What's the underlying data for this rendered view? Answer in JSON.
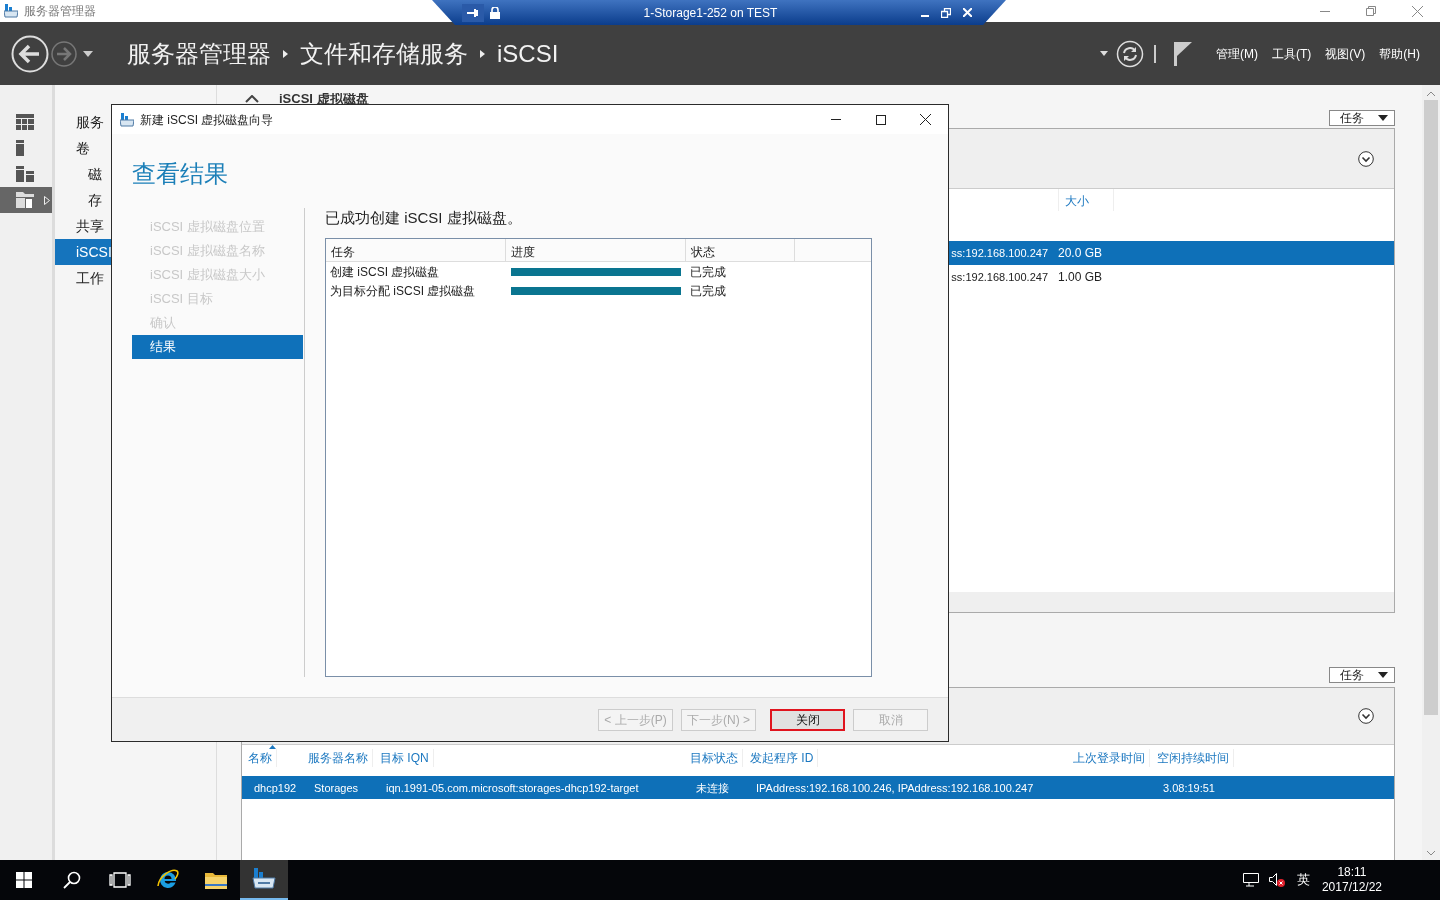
{
  "app_title": "服务器管理器",
  "rdp_bar": {
    "title": "1-Storage1-252 on TEST"
  },
  "breadcrumb": [
    "服务器管理器",
    "文件和存储服务",
    "iSCSI"
  ],
  "menu": [
    "管理(M)",
    "工具(T)",
    "视图(V)",
    "帮助(H)"
  ],
  "rail": [
    {
      "kind": "dashboard",
      "selected": false
    },
    {
      "kind": "server",
      "selected": false
    },
    {
      "kind": "servers",
      "selected": false
    },
    {
      "kind": "files",
      "selected": true
    }
  ],
  "nav": [
    {
      "label": "服务",
      "selected": false
    },
    {
      "label": "卷",
      "selected": false,
      "children": [
        {
          "label": "磁",
          "selected": false
        },
        {
          "label": "存",
          "selected": false
        }
      ]
    },
    {
      "label": "共享",
      "selected": false
    },
    {
      "label": "iSCSI",
      "selected": true
    },
    {
      "label": "工作",
      "selected": false
    }
  ],
  "virtual_disks": {
    "title": "iSCSI 虚拟磁盘",
    "tasks": "任务",
    "columns": [
      "",
      "大小"
    ],
    "rows": [
      {
        "cells": [
          "ss:192.168.100.247",
          "20.0 GB"
        ],
        "selected": true
      },
      {
        "cells": [
          "ss:192.168.100.247",
          "1.00 GB"
        ],
        "selected": false
      }
    ]
  },
  "targets": {
    "tasks": "任务",
    "columns": [
      "名称",
      "服务器名称",
      "目标 IQN",
      "目标状态",
      "发起程序 ID",
      "上次登录时间",
      "空闲持续时间"
    ],
    "rows": [
      {
        "cells": [
          "dhcp192",
          "Storages",
          "iqn.1991-05.com.microsoft:storages-dhcp192-target",
          "未连接",
          "IPAddress:192.168.100.246, IPAddress:192.168.100.247",
          "",
          "3.08:19:51"
        ],
        "selected": true
      }
    ]
  },
  "dialog": {
    "title": "新建 iSCSI 虚拟磁盘向导",
    "heading": "查看结果",
    "steps": [
      {
        "label": "iSCSI 虚拟磁盘位置",
        "selected": false
      },
      {
        "label": "iSCSI 虚拟磁盘名称",
        "selected": false
      },
      {
        "label": "iSCSI 虚拟磁盘大小",
        "selected": false
      },
      {
        "label": "iSCSI 目标",
        "selected": false
      },
      {
        "label": "确认",
        "selected": false
      },
      {
        "label": "结果",
        "selected": true
      }
    ],
    "message": "已成功创建 iSCSI 虚拟磁盘。",
    "columns": [
      "任务",
      "进度",
      "状态"
    ],
    "rows": [
      {
        "task": "创建 iSCSI 虚拟磁盘",
        "level": 1,
        "status": "已完成"
      },
      {
        "task": "为目标分配 iSCSI 虚拟磁盘",
        "level": 1,
        "status": "已完成"
      }
    ],
    "buttons": [
      {
        "label": "< 上一步(P)",
        "disabled": true,
        "focused": false
      },
      {
        "label": "下一步(N) >",
        "disabled": true,
        "focused": false
      },
      {
        "label": "关闭",
        "disabled": false,
        "focused": true
      },
      {
        "label": "取消",
        "disabled": true,
        "focused": false
      }
    ]
  },
  "taskbar": {
    "apps": [
      {
        "kind": "start",
        "active": false
      },
      {
        "kind": "search",
        "active": false
      },
      {
        "kind": "task-view",
        "active": false
      },
      {
        "kind": "browser",
        "active": false
      },
      {
        "kind": "folder",
        "active": false
      },
      {
        "kind": "server-manager",
        "active": true
      }
    ],
    "input": "英",
    "time": "18:11",
    "date": "2017/12/22"
  }
}
